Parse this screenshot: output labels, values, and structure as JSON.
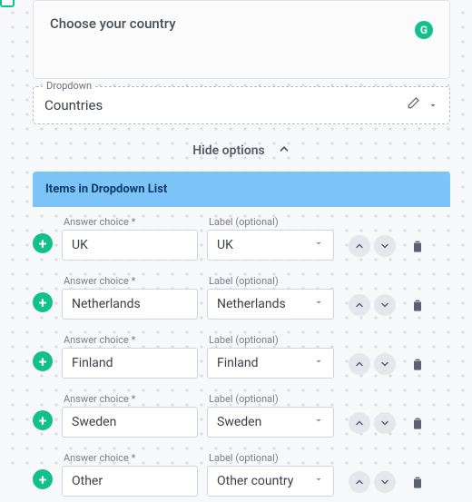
{
  "preview": {
    "question": "Choose your country",
    "badge_letter": "G"
  },
  "dropdown_field": {
    "legend": "Dropdown",
    "name": "Countries"
  },
  "toggle": {
    "label": "Hide options"
  },
  "items_header": "Items in Dropdown List",
  "labels": {
    "answer": "Answer choice *",
    "label": "Label (optional)"
  },
  "icons": {
    "plus": "+"
  },
  "items": [
    {
      "answer": "UK",
      "label": "UK"
    },
    {
      "answer": "Netherlands",
      "label": "Netherlands"
    },
    {
      "answer": "Finland",
      "label": "Finland"
    },
    {
      "answer": "Sweden",
      "label": "Sweden"
    },
    {
      "answer": "Other",
      "label": "Other country"
    }
  ]
}
